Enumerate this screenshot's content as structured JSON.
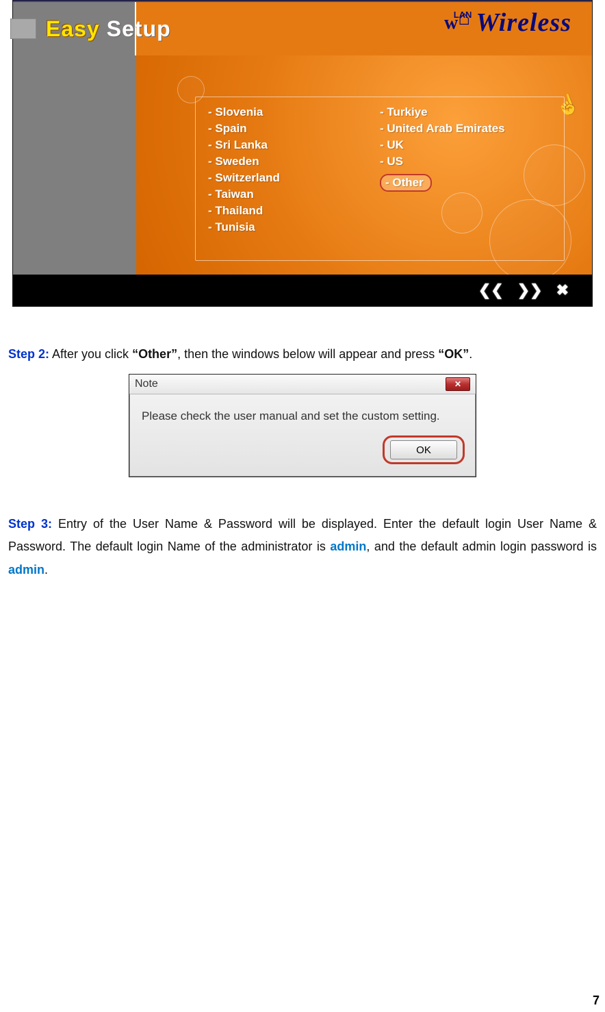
{
  "page_number": "7",
  "screenshot1": {
    "title_left": "Easy",
    "title_right": "Setup",
    "brand_small": "LAN",
    "brand_w": "w",
    "brand_text": "Wireless",
    "countries_col1": [
      "- Slovenia",
      "- Spain",
      "- Sri Lanka",
      "- Sweden",
      "- Switzerland",
      "- Taiwan",
      "- Thailand",
      "- Tunisia"
    ],
    "countries_col2": [
      "- Turkiye",
      "- United Arab Emirates",
      "- UK",
      "- US",
      "- Other"
    ],
    "highlighted_index_col2": 4
  },
  "step2": {
    "label": "Step 2:",
    "text_a": " After you click ",
    "bold_a": "“Other”",
    "text_b": ", then the windows below will appear and press ",
    "bold_b": "“OK”",
    "text_c": "."
  },
  "dialog": {
    "title": "Note",
    "message": "Please check the user manual and set the custom setting.",
    "ok_label": "OK"
  },
  "step3": {
    "label": "Step 3:",
    "t1": " Entry of the User Name & Password will be displayed. Enter the default login User Name & Password. The default login Name of the administrator is ",
    "admin1": "admin",
    "t2": ", and the default admin login password is ",
    "admin2": "admin",
    "t3": "."
  }
}
